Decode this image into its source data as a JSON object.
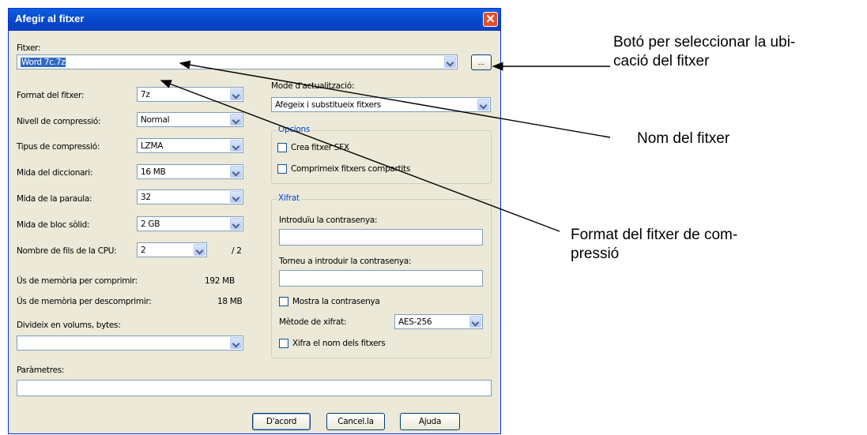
{
  "window": {
    "title": "Afegir al fitxer"
  },
  "file": {
    "label": "Fitxer:",
    "value": "Word 7c.7z",
    "browse_label": "..."
  },
  "left": {
    "format": {
      "label": "Format del fitxer:",
      "value": "7z"
    },
    "level": {
      "label": "Nivell de compressió:",
      "value": "Normal"
    },
    "method": {
      "label": "Tipus de compressió:",
      "value": "LZMA"
    },
    "dict": {
      "label": "Mida del diccionari:",
      "value": "16 MB"
    },
    "word": {
      "label": "Mida de la paraula:",
      "value": "32"
    },
    "block": {
      "label": "Mida de bloc sòlid:",
      "value": "2 GB"
    },
    "threads": {
      "label": "Nombre de fils de la CPU:",
      "value": "2",
      "max": "/ 2"
    },
    "mem_comp": {
      "label": "Ús de memòria per comprimir:",
      "value": "192 MB"
    },
    "mem_decomp": {
      "label": "Ús de memòria per descomprimir:",
      "value": "18 MB"
    },
    "volumes": {
      "label": "Divideix en volums, bytes:",
      "value": ""
    },
    "params": {
      "label": "Paràmetres:",
      "value": ""
    }
  },
  "right": {
    "update": {
      "label": "Mode d'actualització:",
      "value": "Afegeix i substitueix fitxers"
    },
    "options": {
      "legend": "Opcions",
      "sfx": "Crea fitxer SFX",
      "shared": "Comprimeix fitxers compartits"
    },
    "encryption": {
      "legend": "Xifrat",
      "pwd_label": "Introduïu la contrasenya:",
      "pwd2_label": "Torneu a introduir la contrasenya:",
      "show": "Mostra la contrasenya",
      "method_label": "Mètode de xifrat:",
      "method_value": "AES-256",
      "names": "Xifra el nom dels fitxers"
    }
  },
  "buttons": {
    "ok": "D'acord",
    "cancel": "Cancel.la",
    "help": "Ajuda"
  },
  "annotations": {
    "browse_line1": "Botó per seleccionar la ubi-",
    "browse_line2": "cació del fitxer",
    "name": "Nom del fitxer",
    "format_line1": "Format del fitxer de com-",
    "format_line2": "pressió"
  }
}
